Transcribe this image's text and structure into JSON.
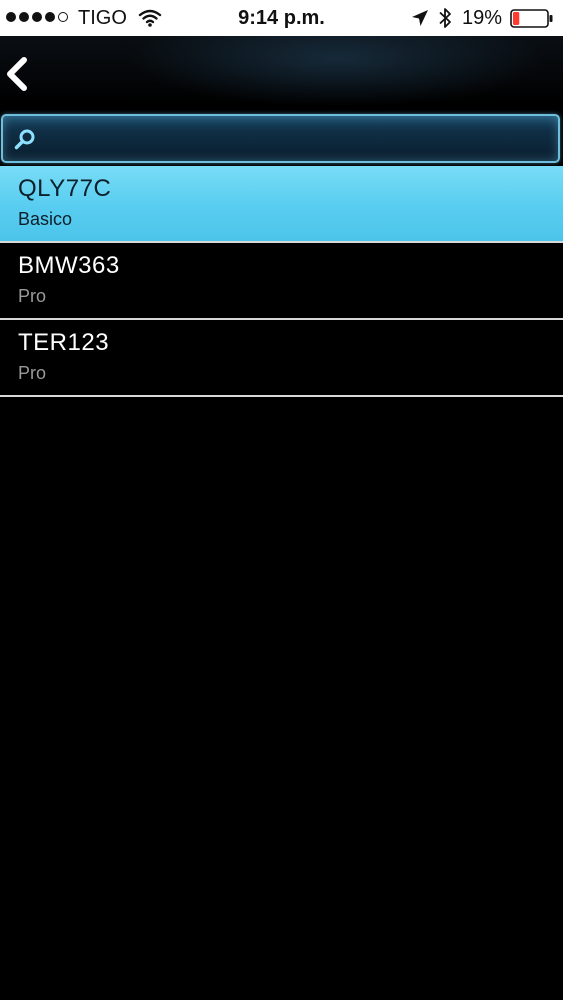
{
  "status_bar": {
    "carrier": "TIGO",
    "time": "9:14 p.m.",
    "battery_percent": "19%",
    "battery_level": 0.19,
    "battery_color": "#ff3b30",
    "signal_bars_filled": 4,
    "signal_bars_total": 5,
    "icons": [
      "wifi-icon",
      "location-icon",
      "bluetooth-icon",
      "battery-icon"
    ]
  },
  "nav": {
    "back_icon": "chevron-left-icon"
  },
  "search": {
    "value": "",
    "placeholder": "",
    "icon": "search-icon"
  },
  "list": {
    "items": [
      {
        "title": "QLY77C",
        "subtitle": "Basico",
        "selected": true
      },
      {
        "title": "BMW363",
        "subtitle": "Pro",
        "selected": false
      },
      {
        "title": "TER123",
        "subtitle": "Pro",
        "selected": false
      }
    ]
  },
  "colors": {
    "accent": "#58cdf0",
    "background": "#000000",
    "divider": "#d8d8d8"
  }
}
